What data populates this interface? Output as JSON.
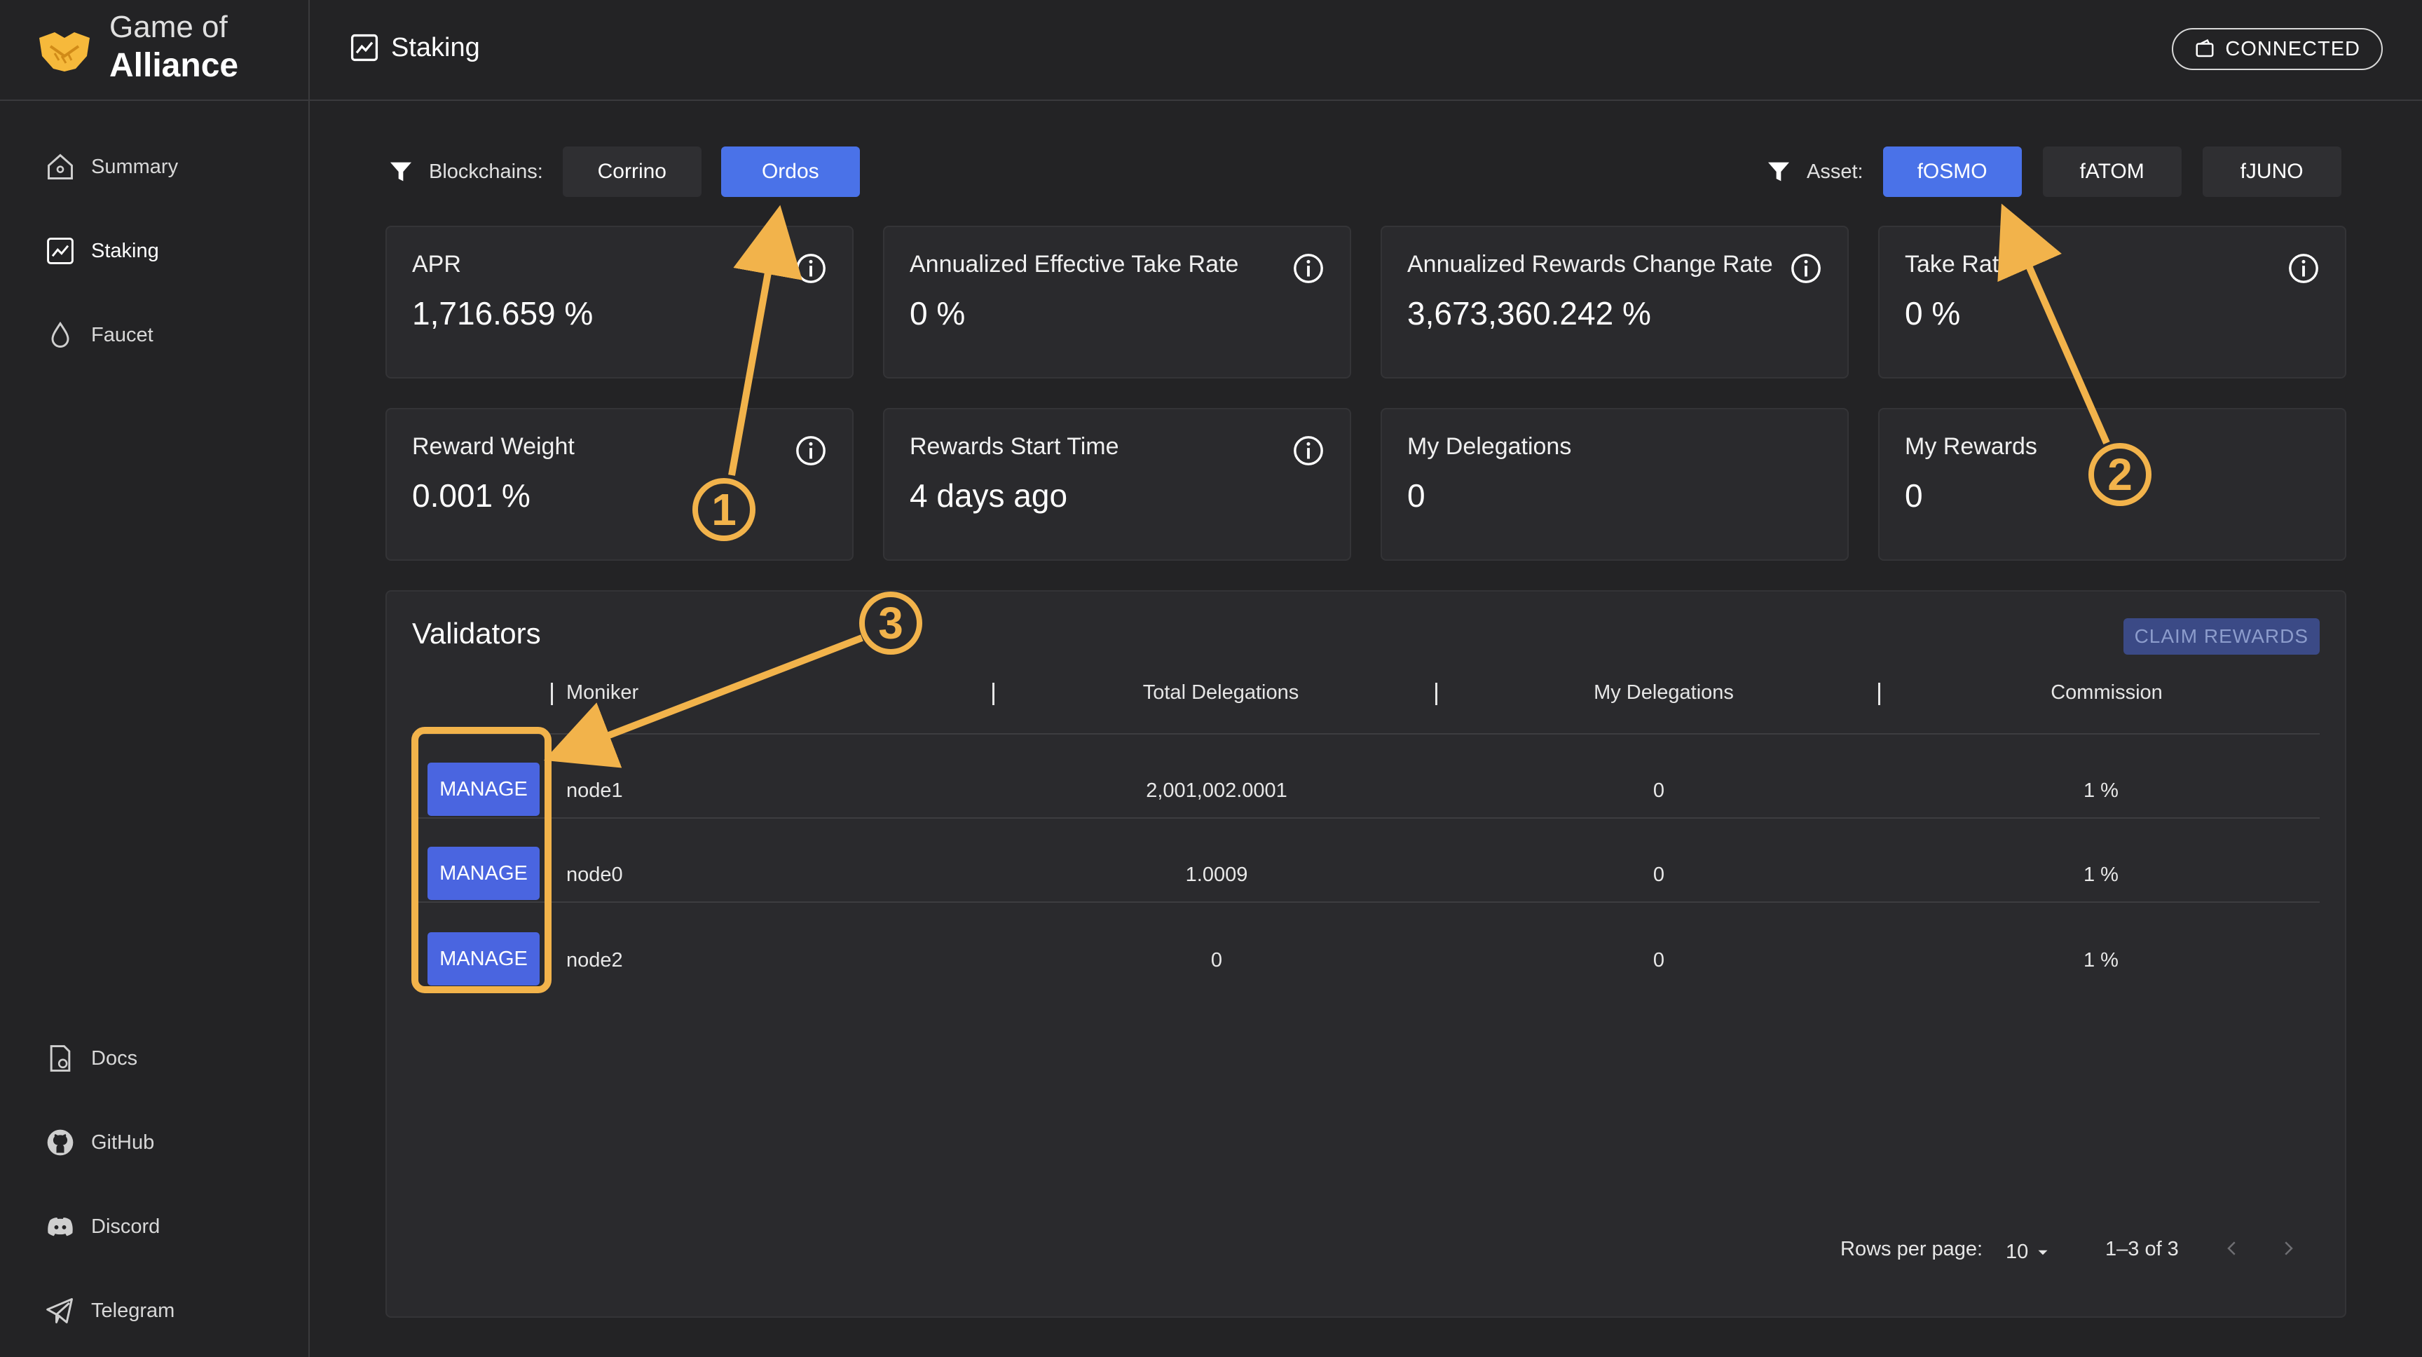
{
  "brand": {
    "line1": "Game of",
    "line2": "Alliance"
  },
  "sidebar": {
    "items": [
      {
        "label": "Summary",
        "icon": "home-icon"
      },
      {
        "label": "Staking",
        "icon": "chart-icon",
        "active": true
      },
      {
        "label": "Faucet",
        "icon": "droplet-icon"
      }
    ],
    "bottom_items": [
      {
        "label": "Docs",
        "icon": "docs-icon"
      },
      {
        "label": "GitHub",
        "icon": "github-icon"
      },
      {
        "label": "Discord",
        "icon": "discord-icon"
      },
      {
        "label": "Telegram",
        "icon": "telegram-icon"
      }
    ]
  },
  "header": {
    "title": "Staking",
    "connected_label": "CONNECTED"
  },
  "filters": {
    "blockchains_label": "Blockchains:",
    "blockchains": [
      "Corrino",
      "Ordos"
    ],
    "blockchain_selected": "Ordos",
    "asset_label": "Asset:",
    "assets": [
      "fOSMO",
      "fATOM",
      "fJUNO"
    ],
    "asset_selected": "fOSMO"
  },
  "stats": [
    {
      "label": "APR",
      "value": "1,716.659 %",
      "info": true
    },
    {
      "label": "Annualized Effective Take Rate",
      "value": "0 %",
      "info": true
    },
    {
      "label": "Annualized Rewards Change Rate",
      "value": "3,673,360.242 %",
      "info": true
    },
    {
      "label": "Take Rate",
      "value": "0 %",
      "info": true
    },
    {
      "label": "Reward Weight",
      "value": "0.001 %",
      "info": true
    },
    {
      "label": "Rewards Start Time",
      "value": "4 days ago",
      "info": true
    },
    {
      "label": "My Delegations",
      "value": "0",
      "info": false
    },
    {
      "label": "My Rewards",
      "value": "0",
      "info": false
    }
  ],
  "validators": {
    "title": "Validators",
    "claim_label": "CLAIM REWARDS",
    "columns": [
      "Moniker",
      "Total Delegations",
      "My Delegations",
      "Commission"
    ],
    "manage_label": "MANAGE",
    "rows": [
      {
        "moniker": "node1",
        "total": "2,001,002.0001",
        "mine": "0",
        "commission": "1 %"
      },
      {
        "moniker": "node0",
        "total": "1.0009",
        "mine": "0",
        "commission": "1 %"
      },
      {
        "moniker": "node2",
        "total": "0",
        "mine": "0",
        "commission": "1 %"
      }
    ],
    "rows_per_page_label": "Rows per page:",
    "rows_per_page": "10",
    "range": "1–3 of 3"
  },
  "annotations": [
    "1",
    "2",
    "3"
  ],
  "colors": {
    "accent": "#4a72e8",
    "annotation": "#f2b34b",
    "background": "#232325"
  }
}
